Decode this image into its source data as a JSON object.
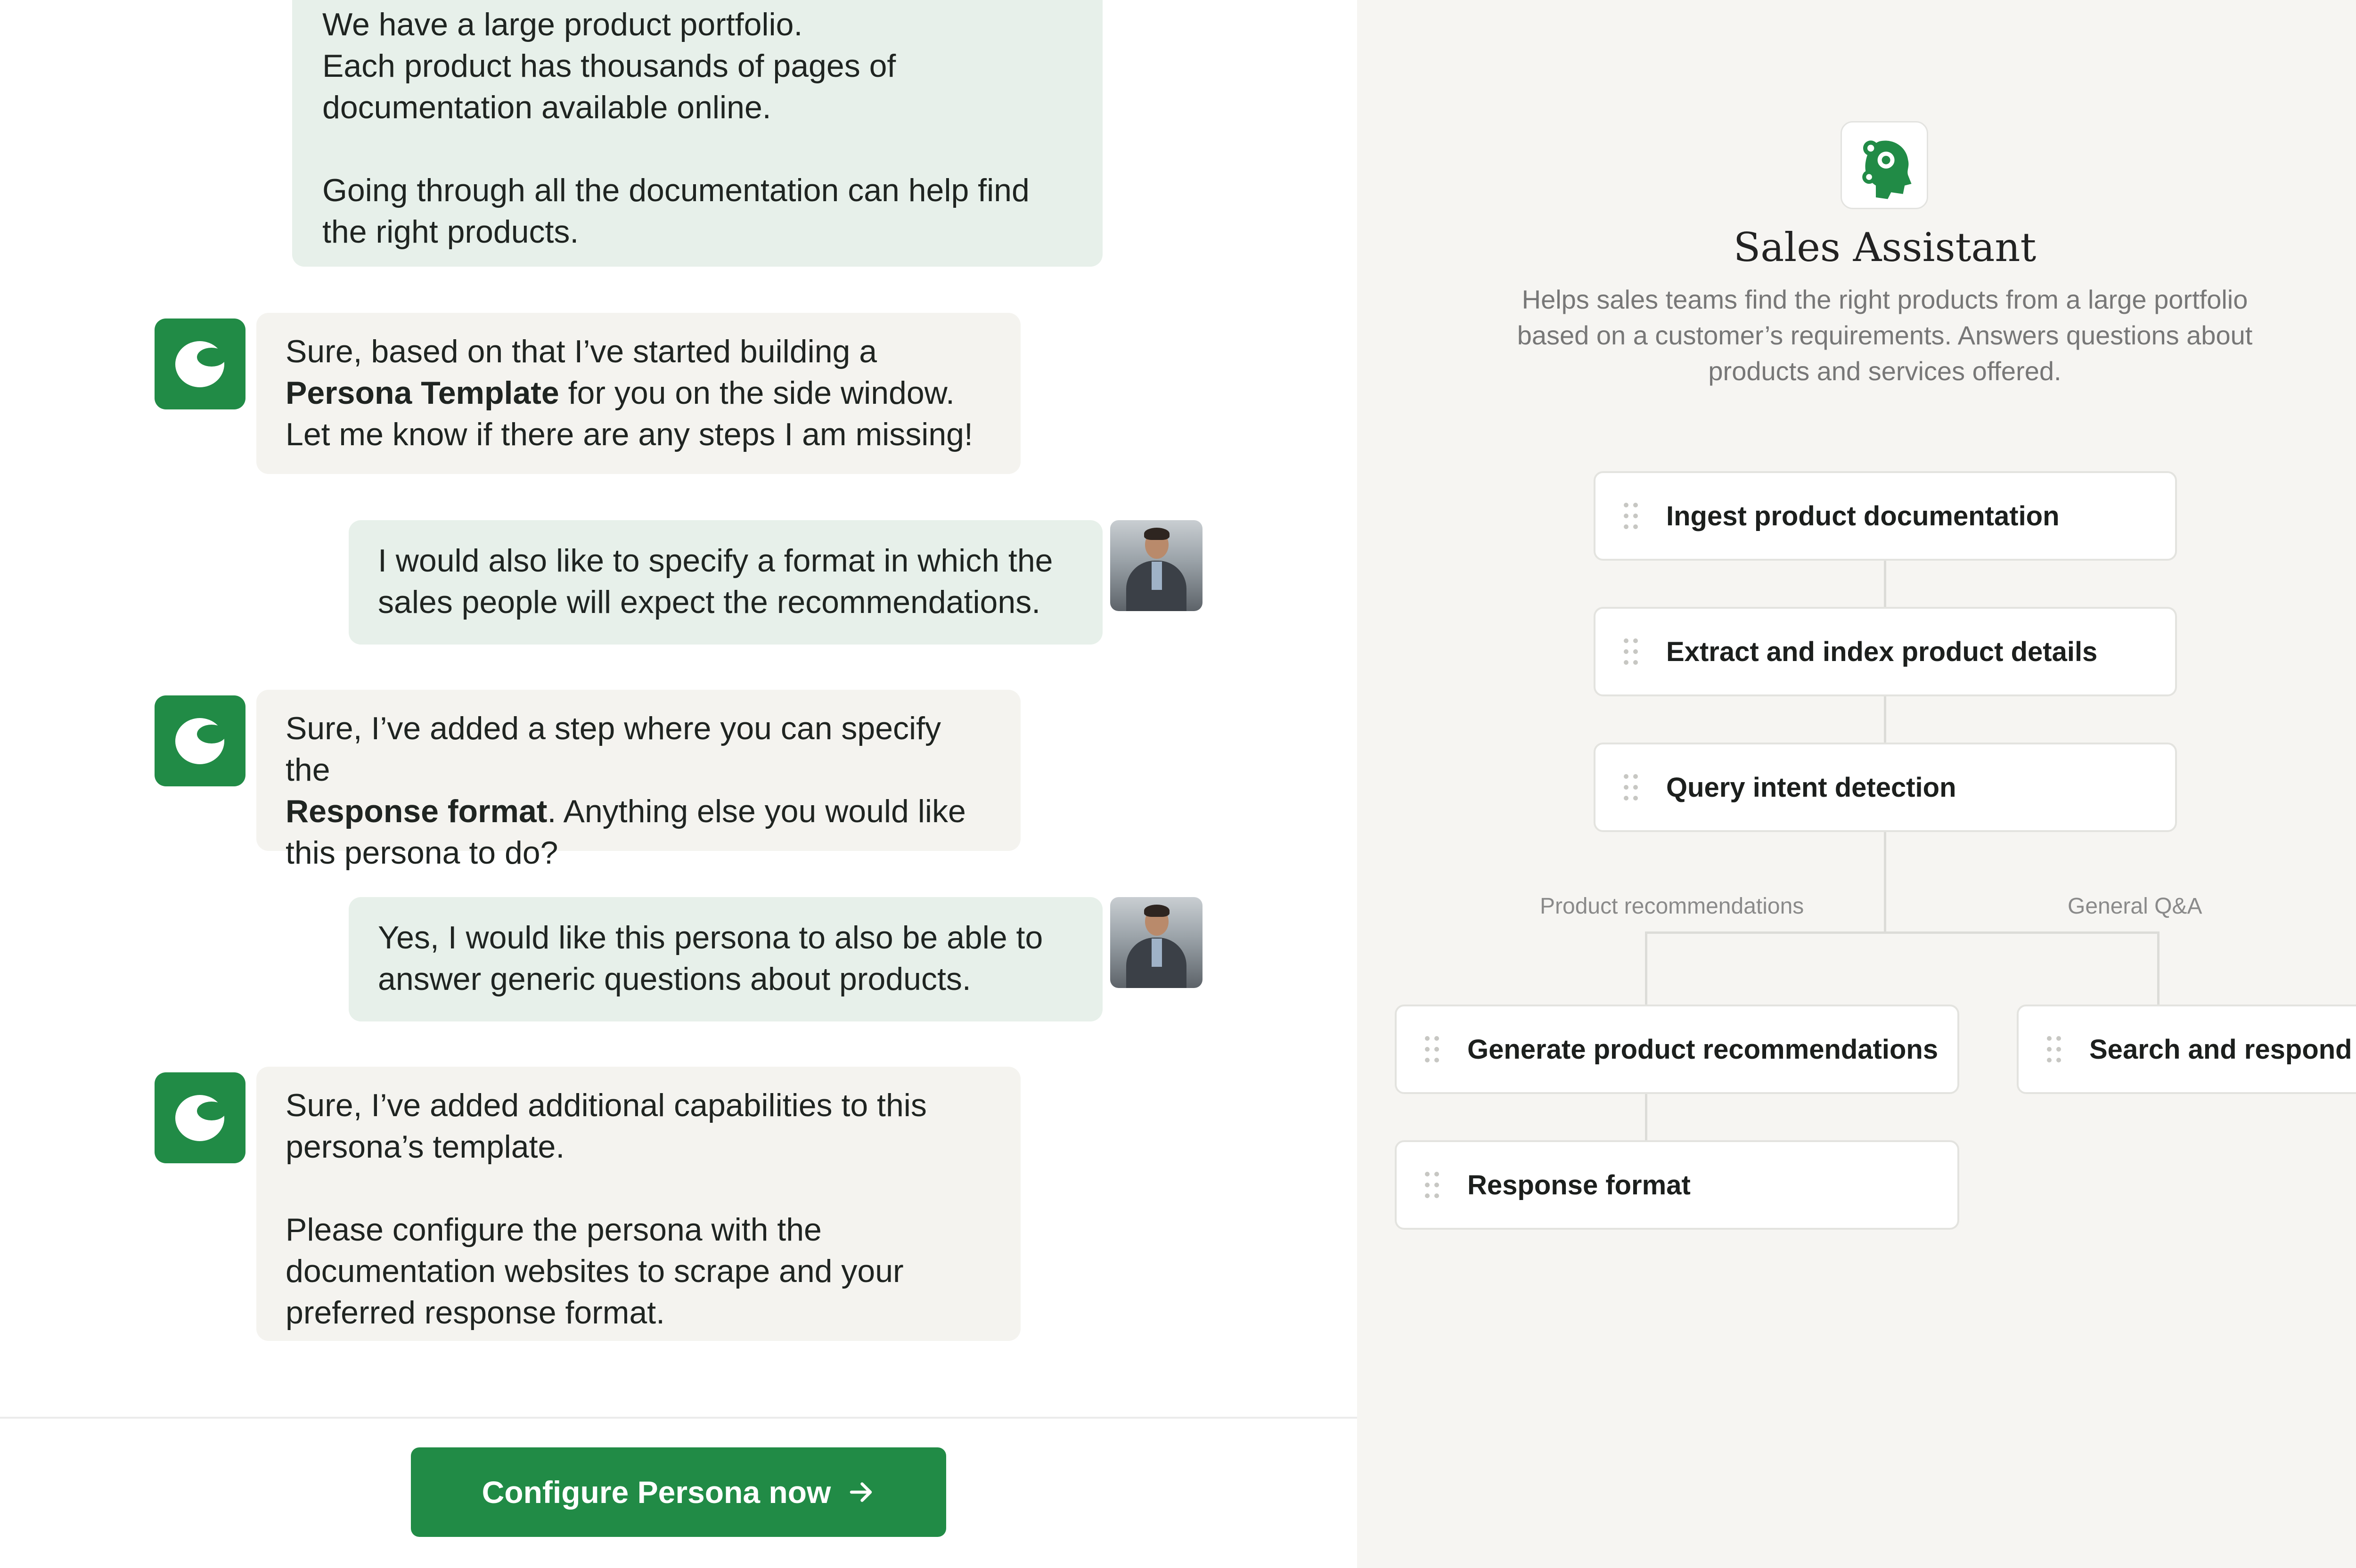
{
  "chat": {
    "messages": [
      {
        "role": "user",
        "text": "We have a large product portfolio.\nEach product has thousands of pages of\ndocumentation available online.\n\nGoing through all the documentation can help find\nthe right products."
      },
      {
        "role": "assistant",
        "pre": "Sure, based on that I’ve started building a\n",
        "bold": "Persona Template",
        "post": " for you on the side window.\nLet me know if there are any steps I am missing!"
      },
      {
        "role": "user",
        "text": "I would also like to specify a format in which the\nsales people will expect the recommendations."
      },
      {
        "role": "assistant",
        "pre": "Sure, I’ve added a step where you can specify the\n",
        "bold": "Response format",
        "post": ". Anything else you would like\nthis persona to do?"
      },
      {
        "role": "user",
        "text": "Yes, I would like this persona to also be able to\nanswer generic questions about products."
      },
      {
        "role": "assistant",
        "text": "Sure, I’ve added additional capabilities to this\npersona’s template.\n\nPlease configure the persona with the\ndocumentation websites to scrape and your\npreferred response format."
      }
    ]
  },
  "cta": {
    "label": "Configure Persona now",
    "icon": "arrow-right-icon"
  },
  "persona": {
    "icon": "gear-head-icon",
    "title": "Sales Assistant",
    "description": "Helps sales teams find the right products from a large portfolio based on a customer’s requirements. Answers questions about products and services offered."
  },
  "workflow": {
    "steps": [
      "Ingest product documentation",
      "Extract and index product details",
      "Query intent detection"
    ],
    "branches": [
      {
        "label": "Product recommendations",
        "steps": [
          "Generate product recommendations",
          "Response format"
        ]
      },
      {
        "label": "General Q&A",
        "steps": [
          "Search and respond"
        ]
      }
    ]
  },
  "colors": {
    "accent": "#218b46",
    "user_bubble": "#e7f0ea",
    "bot_bubble": "#f4f3ef",
    "panel": "#f6f5f2"
  }
}
